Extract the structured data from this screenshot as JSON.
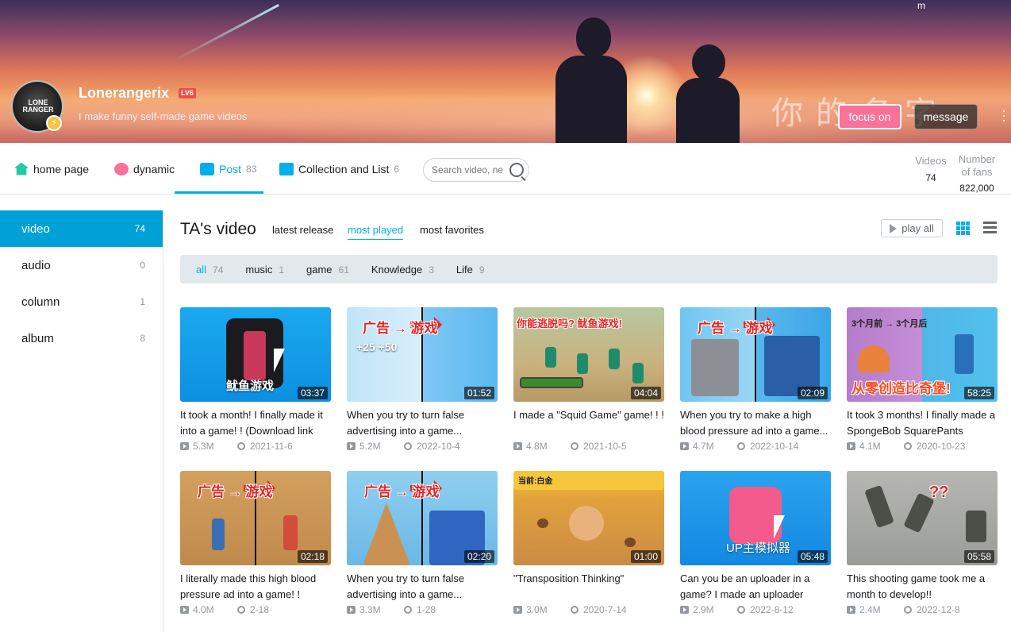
{
  "banner": {
    "chinese_title": "你的名字",
    "top_icon": "m"
  },
  "profile": {
    "avatar_text": "LONE RANGER",
    "username": "Lonerangerix",
    "level": "LV6",
    "bio": "I make funny self-made game videos",
    "follow_label": "focus on",
    "message_label": "message",
    "more_icon": "⋮"
  },
  "nav": {
    "items": [
      {
        "label": "home page",
        "icon": "home-icon",
        "color": "#23c9a0"
      },
      {
        "label": "dynamic",
        "icon": "dynamic-icon",
        "color": "#fb7299"
      },
      {
        "label": "Post",
        "count": "83",
        "icon": "post-icon",
        "color": "#00aeec"
      },
      {
        "label": "Collection and List",
        "count": "6",
        "icon": "collection-icon",
        "color": "#00aeec"
      }
    ],
    "search_placeholder": "Search video, ne",
    "stats": [
      {
        "label": "Videos",
        "value": "74"
      },
      {
        "label": "Number of fans",
        "value": "822,000"
      }
    ]
  },
  "sidebar": {
    "items": [
      {
        "label": "video",
        "count": "74"
      },
      {
        "label": "audio",
        "count": "0"
      },
      {
        "label": "column",
        "count": "1"
      },
      {
        "label": "album",
        "count": "8"
      }
    ]
  },
  "main": {
    "title": "TA's video",
    "sorts": [
      "latest release",
      "most played",
      "most favorites"
    ],
    "active_sort": "most played",
    "play_all": "play all",
    "filters": [
      {
        "label": "all",
        "count": "74"
      },
      {
        "label": "music",
        "count": "1"
      },
      {
        "label": "game",
        "count": "61"
      },
      {
        "label": "Knowledge",
        "count": "3"
      },
      {
        "label": "Life",
        "count": "9"
      }
    ]
  },
  "videos": [
    {
      "title": "It took a month! I finally made it into a game! ! (Download link",
      "duration": "03:37",
      "views": "5.3M",
      "date": "2021-11-6",
      "thumb_text": "鱿鱼游戏"
    },
    {
      "title": "When you try to turn false advertising into a game...",
      "duration": "01:52",
      "views": "5.2M",
      "date": "2022-10-4",
      "thumb_text": "广告 → 游戏",
      "thumb_extra": "+25 +50"
    },
    {
      "title": "I made a \"Squid Game\" game! ! !",
      "duration": "04:04",
      "views": "4.8M",
      "date": "2021-10-5",
      "thumb_text": "你能逃脱吗? 鱿鱼游戏!"
    },
    {
      "title": "When you try to make a high blood pressure ad into a game...",
      "duration": "02:09",
      "views": "4.7M",
      "date": "2022-10-14",
      "thumb_text": "广告 → 游戏"
    },
    {
      "title": "It took 3 months! I finally made a SpongeBob SquarePants",
      "duration": "58:25",
      "views": "4.1M",
      "date": "2020-10-23",
      "thumb_text": "从零创造比奇堡!",
      "thumb_extra": "3个月前 → 3个月后"
    },
    {
      "title": "I literally made this high blood pressure ad into a game! !",
      "duration": "02:18",
      "views": "4.0M",
      "date": "2-18",
      "thumb_text": "广告 → 游戏"
    },
    {
      "title": "When you try to turn false advertising into a game...",
      "duration": "02:20",
      "views": "3.3M",
      "date": "1-28",
      "thumb_text": "广告 → 游戏"
    },
    {
      "title": "\"Transposition Thinking\"",
      "duration": "01:00",
      "views": "3.0M",
      "date": "2020-7-14",
      "thumb_text": "当前:白金"
    },
    {
      "title": "Can you be an uploader in a game? I made an uploader",
      "duration": "05:48",
      "views": "2.9M",
      "date": "2022-8-12",
      "thumb_text": "UP主模拟器"
    },
    {
      "title": "This shooting game took me a month to develop!!",
      "duration": "05:58",
      "views": "2.4M",
      "date": "2022-12-8",
      "thumb_text": "??"
    }
  ]
}
